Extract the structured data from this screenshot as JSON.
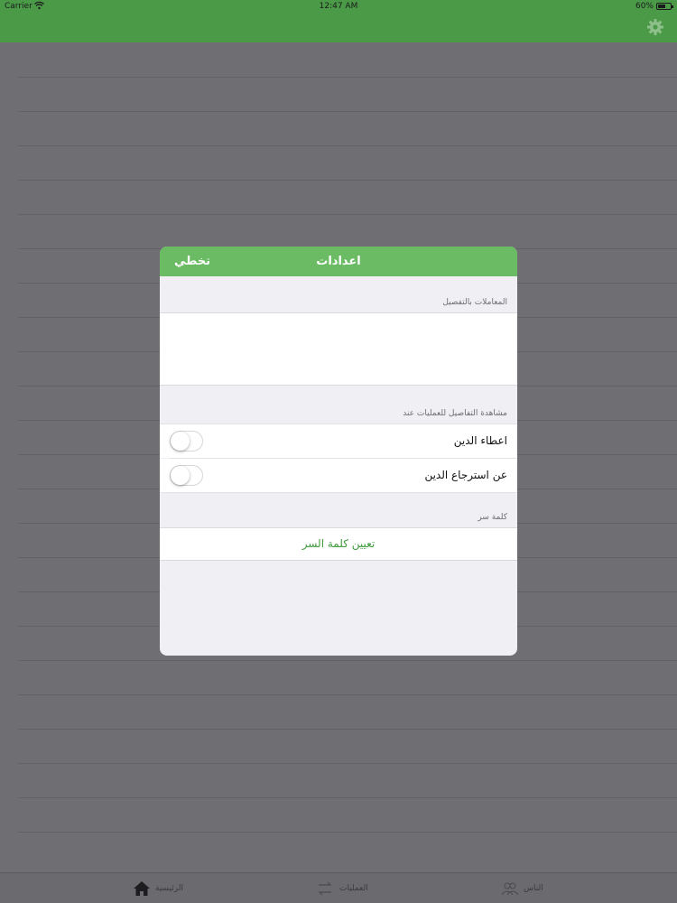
{
  "status_bar": {
    "carrier": "Carrier",
    "time": "12:47 AM",
    "battery": "60%"
  },
  "nav_bar": {
    "settings_icon": "gear-icon"
  },
  "tab_bar": {
    "tabs": [
      {
        "label": "الرئيسية",
        "icon": "home-icon"
      },
      {
        "label": "العمليات",
        "icon": "transactions-icon"
      },
      {
        "label": "الناس",
        "icon": "people-icon"
      }
    ]
  },
  "modal": {
    "title": "اعدادات",
    "skip_label": "تخطي",
    "sections": {
      "detailed_transactions_header": "المعاملات بالتفصيل",
      "view_details_header": "مشاهدة التفاصيل للعمليات عند",
      "password_header": "كلمة سر"
    },
    "rows": {
      "give_debt": "اعطاء الدين",
      "debt_return": "عن استرجاع الدين"
    },
    "toggles": {
      "give_debt_on": false,
      "debt_return_on": false
    },
    "set_password_label": "تعيين كلمة السر"
  },
  "colors": {
    "green_bar": "#4a9a48",
    "modal_header": "#6abb63",
    "link_green": "#3e9a3c",
    "overlay_gray": "#6f6f73"
  }
}
